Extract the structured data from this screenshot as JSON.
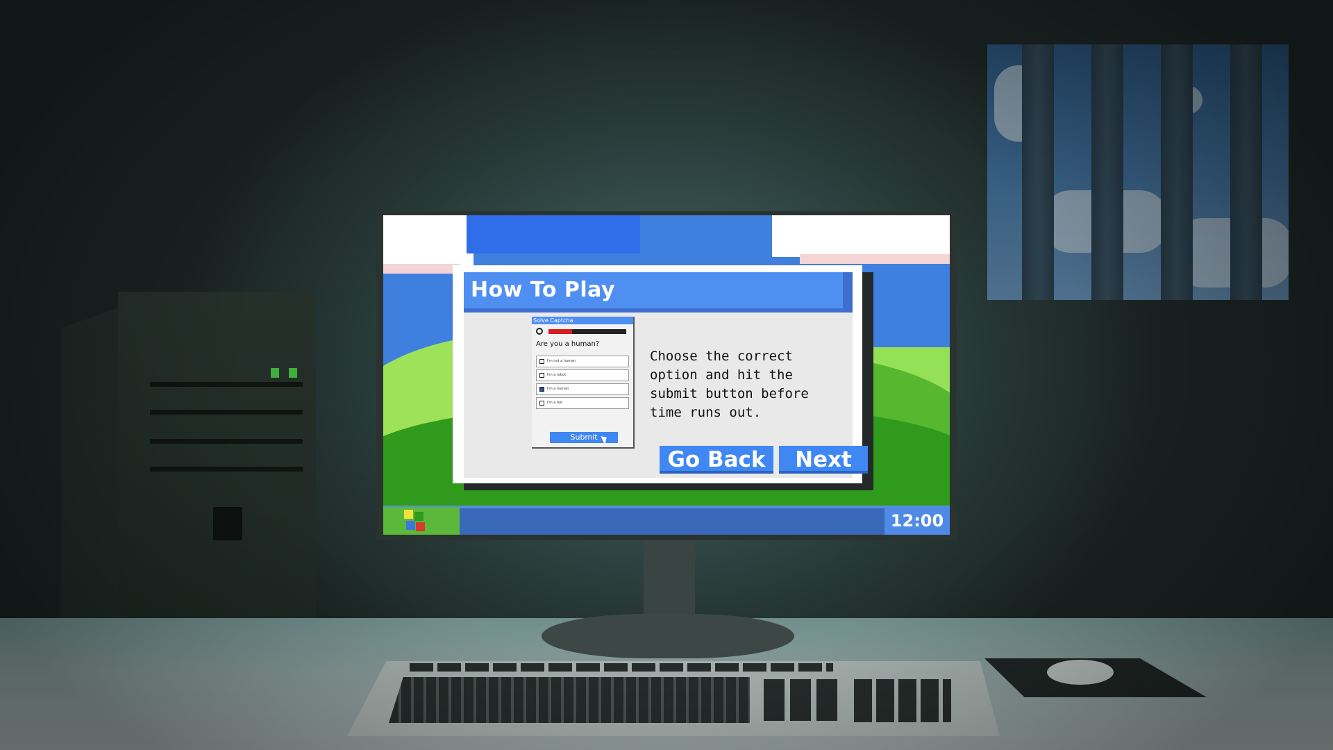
{
  "dialog": {
    "title": "How To Play",
    "instructions": "Choose the correct\noption and hit the\nsubmit button before\ntime runs out.",
    "back_label": "Go Back",
    "next_label": "Next"
  },
  "preview": {
    "window_title": "Solve Captcha",
    "question": "Are you a human?",
    "timer_remaining": 0.3,
    "options": [
      {
        "label": "I'm not a human",
        "checked": false
      },
      {
        "label": "I'm a robot",
        "checked": false
      },
      {
        "label": "I'm a human",
        "checked": true
      },
      {
        "label": "I'm a bot",
        "checked": false
      }
    ],
    "submit_label": "Submit"
  },
  "taskbar": {
    "clock": "12:00"
  },
  "colors": {
    "accent": "#4f8ff2",
    "button": "#3f87f2",
    "taskbar": "#3a68b8",
    "start": "#5bb83a",
    "timer_bar": "#d91c1c",
    "tower_led": "#3fae3a"
  },
  "icons": {
    "start": "start-logo-icon",
    "clock": "clock-icon",
    "cursor": "mouse-pointer-icon"
  }
}
